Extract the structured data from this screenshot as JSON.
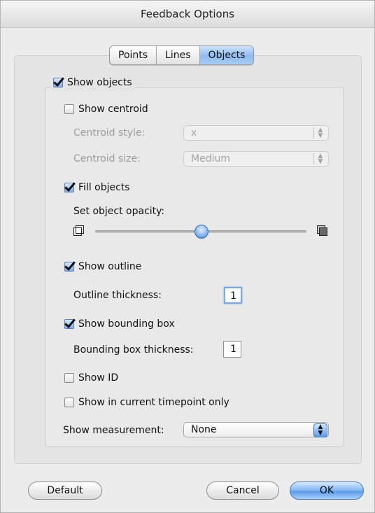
{
  "window": {
    "title": "Feedback Options"
  },
  "tabs": [
    {
      "label": "Points",
      "active": false
    },
    {
      "label": "Lines",
      "active": false
    },
    {
      "label": "Objects",
      "active": true
    }
  ],
  "show_objects": {
    "label": "Show objects",
    "checked": true
  },
  "show_centroid": {
    "label": "Show centroid",
    "checked": false
  },
  "centroid_style": {
    "label": "Centroid style:",
    "value": "x"
  },
  "centroid_size": {
    "label": "Centroid size:",
    "value": "Medium"
  },
  "fill_objects": {
    "label": "Fill objects",
    "checked": true
  },
  "opacity": {
    "label": "Set object opacity:",
    "value": 0.5
  },
  "show_outline": {
    "label": "Show outline",
    "checked": true
  },
  "outline_thickness": {
    "label": "Outline thickness:",
    "value": "1"
  },
  "show_bbox": {
    "label": "Show bounding box",
    "checked": true
  },
  "bbox_thickness": {
    "label": "Bounding box thickness:",
    "value": "1"
  },
  "show_id": {
    "label": "Show ID",
    "checked": false
  },
  "show_current": {
    "label": "Show in current timepoint only",
    "checked": false
  },
  "measurement": {
    "label": "Show measurement:",
    "value": "None"
  },
  "buttons": {
    "default": "Default",
    "cancel": "Cancel",
    "ok": "OK"
  },
  "colors": {
    "accent": "#6fa6ec",
    "window_bg": "#ececec"
  }
}
